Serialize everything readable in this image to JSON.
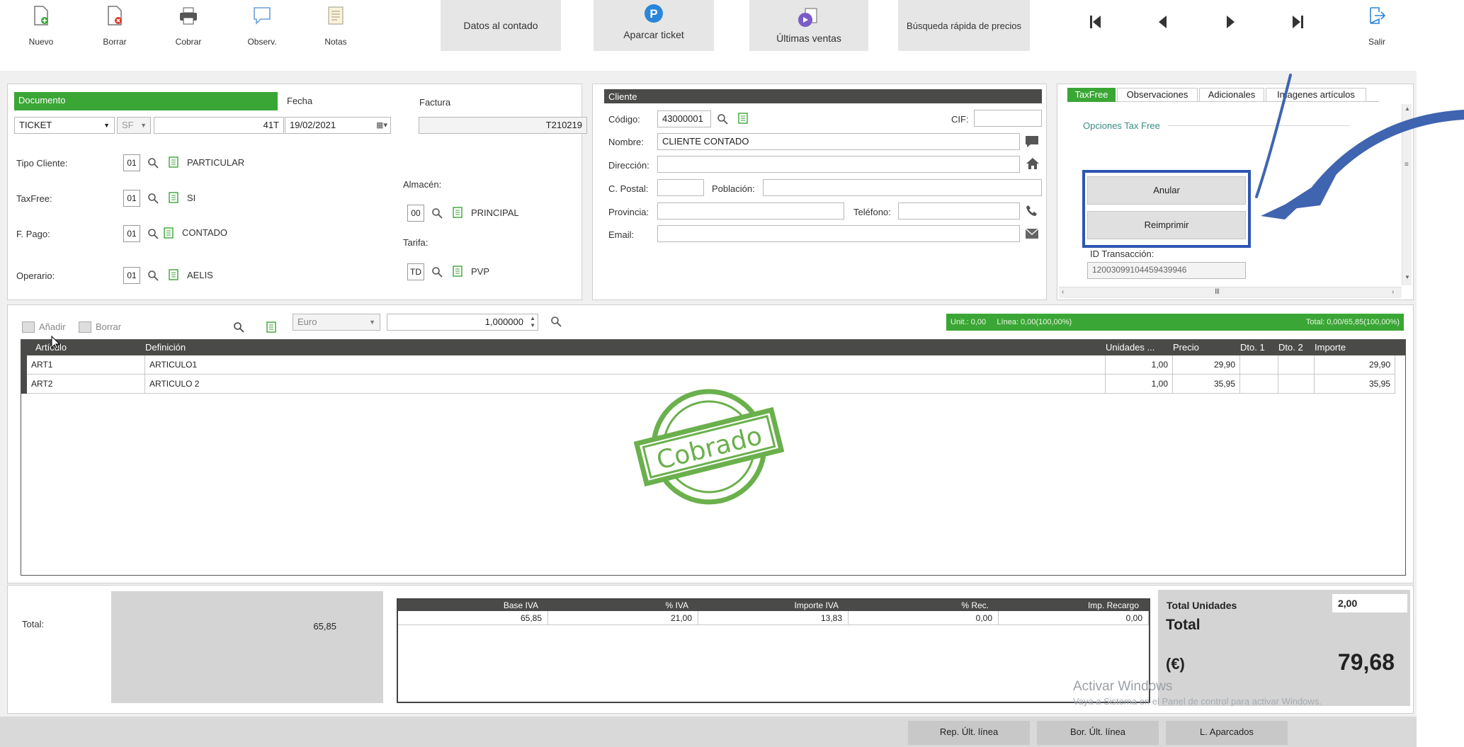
{
  "toolbar": {
    "nuevo": "Nuevo",
    "borrar": "Borrar",
    "cobrar": "Cobrar",
    "observ": "Observ.",
    "notas": "Notas",
    "datos_contado": "Datos al contado",
    "aparcar": "Aparcar ticket",
    "ultimas": "Últimas ventas",
    "busqueda": "Búsqueda rápida de precios",
    "salir": "Salir"
  },
  "documento": {
    "header": "Documento",
    "tipo": "TICKET",
    "serie": "SF",
    "numero": "41T",
    "fecha_label": "Fecha",
    "fecha": "19/02/2021",
    "factura_label": "Factura",
    "factura": "T210219",
    "tipo_cliente_label": "Tipo Cliente:",
    "tipo_cliente_code": "01",
    "tipo_cliente_value": "PARTICULAR",
    "taxfree_label": "TaxFree:",
    "taxfree_code": "01",
    "taxfree_value": "SI",
    "fpago_label": "F. Pago:",
    "fpago_code": "01",
    "fpago_value": "CONTADO",
    "operario_label": "Operario:",
    "operario_code": "01",
    "operario_value": "AELIS",
    "almacen_label": "Almacén:",
    "almacen_code": "00",
    "almacen_value": "PRINCIPAL",
    "tarifa_label": "Tarifa:",
    "tarifa_code": "TD",
    "tarifa_value": "PVP"
  },
  "cliente": {
    "header": "Cliente",
    "codigo_label": "Código:",
    "codigo": "43000001",
    "cif_label": "CIF:",
    "nombre_label": "Nombre:",
    "nombre": "CLIENTE CONTADO",
    "direccion_label": "Dirección:",
    "cpostal_label": "C. Postal:",
    "poblacion_label": "Población:",
    "provincia_label": "Provincia:",
    "telefono_label": "Teléfono:",
    "email_label": "Email:"
  },
  "taxfree": {
    "tabs": [
      "TaxFree",
      "Observaciones",
      "Adicionales",
      "Imagenes artículos"
    ],
    "opciones": "Opciones Tax Free",
    "anular": "Anular",
    "reimprimir": "Reimprimir",
    "id_label": "ID Transacción:",
    "id_value": "12003099104459439946"
  },
  "lines_toolbar": {
    "anadir": "Añadir",
    "borrar": "Borrar",
    "moneda": "Euro",
    "factor": "1,000000",
    "status_left": "Unit.: 0,00     Línea: 0,00(100,00%)",
    "status_right": "Total: 0,00/65,85(100,00%)"
  },
  "grid": {
    "columns": [
      "Artículo",
      "Definición",
      "Unidades ...",
      "Precio",
      "Dto. 1",
      "Dto. 2",
      "Importe"
    ],
    "rows": [
      {
        "articulo": "ART1",
        "definicion": "ARTICULO1",
        "unidades": "1,00",
        "precio": "29,90",
        "dto1": "",
        "dto2": "",
        "importe": "29,90"
      },
      {
        "articulo": "ART2",
        "definicion": "ARTICULO 2",
        "unidades": "1,00",
        "precio": "35,95",
        "dto1": "",
        "dto2": "",
        "importe": "35,95"
      }
    ],
    "stamp": "Cobrado"
  },
  "totales": {
    "total_label": "Total:",
    "total_value": "65,85",
    "iva_columns": [
      "Base IVA",
      "% IVA",
      "Importe IVA",
      "% Rec.",
      "Imp. Recargo"
    ],
    "iva_row": [
      "65,85",
      "21,00",
      "13,83",
      "0,00",
      "0,00"
    ],
    "total_unidades_label": "Total Unidades",
    "total_unidades": "2,00",
    "total_big_label": "Total",
    "euro_label": "(€)",
    "total_big": "79,68"
  },
  "watermark": {
    "line1": "Activar Windows",
    "line2": "Vaya a Sistema en el Panel de control para activar Windows."
  },
  "footer": {
    "rep": "Rep. Últ. línea",
    "bor": "Bor. Últ. línea",
    "aparcados": "L. Aparcados"
  },
  "colors": {
    "green": "#3aa635",
    "dark_header": "#4a4a48",
    "highlight": "#2e55b4",
    "stamp": "#6ab04c"
  }
}
